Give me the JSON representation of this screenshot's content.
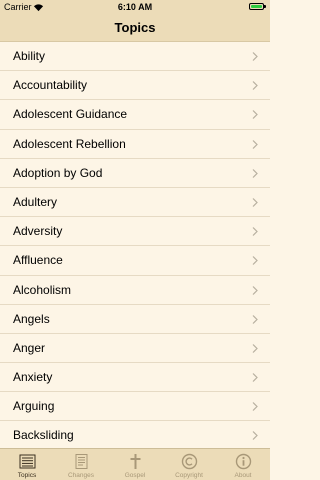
{
  "status": {
    "carrier": "Carrier",
    "time": "6:10 AM"
  },
  "nav": {
    "title": "Topics"
  },
  "topics": [
    "Ability",
    "Accountability",
    "Adolescent Guidance",
    "Adolescent Rebellion",
    "Adoption by God",
    "Adultery",
    "Adversity",
    "Affluence",
    "Alcoholism",
    "Angels",
    "Anger",
    "Anxiety",
    "Arguing",
    "Backsliding"
  ],
  "tabs": [
    {
      "label": "Topics",
      "icon": "list-icon",
      "active": true
    },
    {
      "label": "Changes",
      "icon": "notes-icon",
      "active": false
    },
    {
      "label": "Gospel",
      "icon": "cross-icon",
      "active": false
    },
    {
      "label": "Copyright",
      "icon": "copyright-icon",
      "active": false
    },
    {
      "label": "About",
      "icon": "info-icon",
      "active": false
    }
  ],
  "colors": {
    "bar_background": "#ecdcb8",
    "list_background": "#fdf5e6",
    "tab_active": "#3a2f1f",
    "tab_inactive": "#a89878",
    "battery": "#2ecc40"
  }
}
